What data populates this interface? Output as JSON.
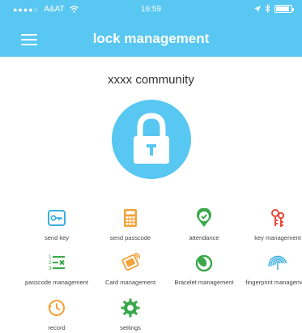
{
  "status_bar": {
    "signal": "●●●●○",
    "carrier": "A&AT",
    "wifi_icon": "wifi-icon",
    "time": "16:59",
    "location_icon": "location-arrow-icon",
    "bluetooth_icon": "bluetooth-icon",
    "battery_level": 0.9
  },
  "header": {
    "menu_icon": "hamburger-menu-icon",
    "title": "lock management"
  },
  "community_name": "xxxx community",
  "lock_button": {
    "icon": "padlock-icon"
  },
  "menu": [
    {
      "label": "send key",
      "icon": "key-icon",
      "color": "#3aaee0"
    },
    {
      "label": "send passcode",
      "icon": "keypad-icon",
      "color": "#f2a23a"
    },
    {
      "label": "attendance",
      "icon": "check-location-icon",
      "color": "#3aa84a"
    },
    {
      "label": "key management",
      "icon": "keys-icon",
      "color": "#e8493b"
    },
    {
      "label": "passcode management",
      "icon": "numbered-list-icon",
      "color": "#3aa84a"
    },
    {
      "label": "Card management",
      "icon": "card-icon",
      "color": "#f2a23a"
    },
    {
      "label": "Bracelet management",
      "icon": "bracelet-icon",
      "color": "#3aa84a"
    },
    {
      "label": "fingerprint management",
      "icon": "fingerprint-icon",
      "color": "#3aaee0"
    },
    {
      "label": "record",
      "icon": "history-icon",
      "color": "#f2a23a"
    },
    {
      "label": "settings",
      "icon": "gear-icon",
      "color": "#3aa84a"
    }
  ],
  "colors": {
    "primary": "#58c7f1",
    "background": "#ffffff",
    "text": "#444444"
  }
}
